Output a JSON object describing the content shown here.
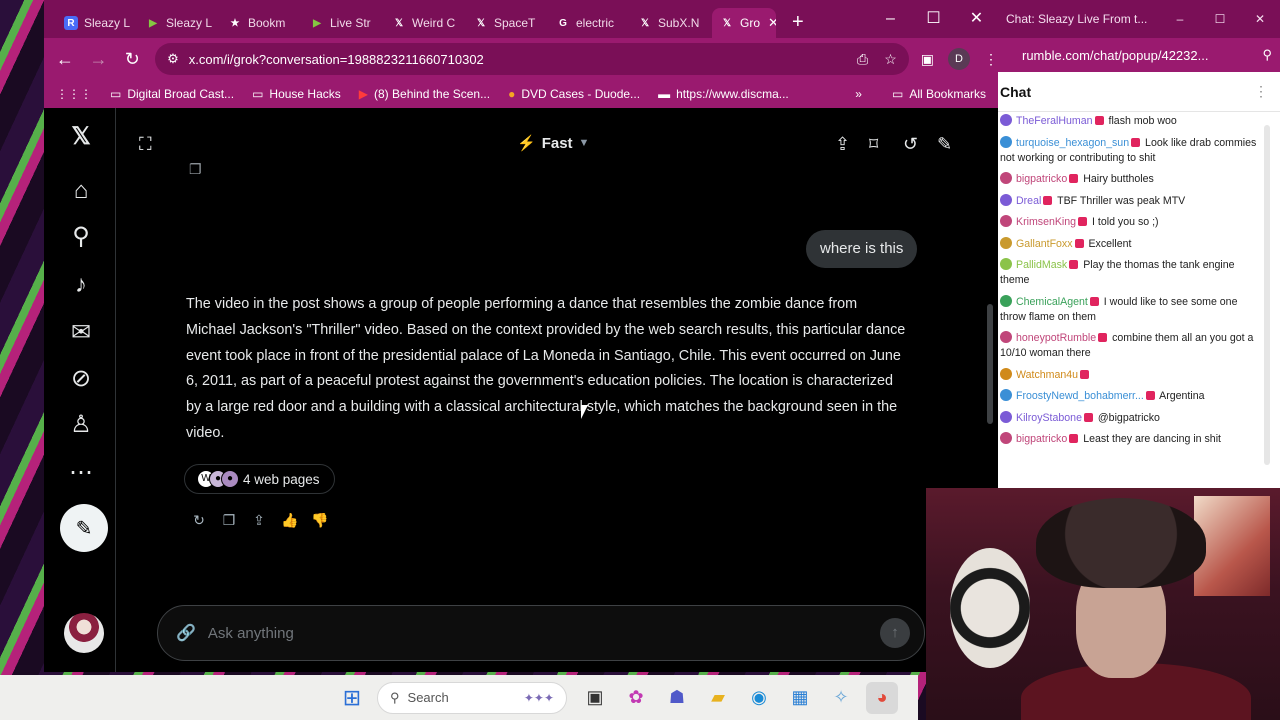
{
  "browser": {
    "tabs": [
      {
        "label": "Sleazy L",
        "icon": "rumble-R",
        "color": "#4a6cf7"
      },
      {
        "label": "Sleazy L",
        "icon": "rumble-play",
        "color": "#85c742"
      },
      {
        "label": "Bookm",
        "icon": "star-icon",
        "color": "#ffffff"
      },
      {
        "label": "Live Str",
        "icon": "rumble-play",
        "color": "#85c742"
      },
      {
        "label": "Weird C",
        "icon": "x-icon",
        "color": "#ffffff"
      },
      {
        "label": "SpaceT",
        "icon": "x-icon",
        "color": "#ffffff"
      },
      {
        "label": "electric",
        "icon": "google-icon",
        "color": "#ffffff"
      },
      {
        "label": "SubX.N",
        "icon": "x-icon",
        "color": "#ffffff"
      },
      {
        "label": "Gro",
        "icon": "x-icon",
        "color": "#ffffff",
        "active": true
      }
    ],
    "url": "x.com/i/grok?conversation=1988823211660710302",
    "profile_initial": "D",
    "bookmarks": [
      "Digital Broad Cast...",
      "House Hacks",
      "(8) Behind the Scen...",
      "DVD Cases - Duode...",
      "https://www.discma..."
    ],
    "all_bookmarks": "All Bookmarks"
  },
  "grok": {
    "model": "Fast",
    "user_message": "where is this",
    "answer": "The video in the post shows a group of people performing a dance that resembles the zombie dance from Michael Jackson's \"Thriller\" video. Based on the context provided by the web search results, this particular dance event took place in front of the presidential palace of La Moneda in Santiago, Chile. This event occurred on June 6, 2011, as part of a peaceful protest against the government's education policies. The location is characterized by a large red door and a building with a classical architectural style, which matches the background seen in the video.",
    "sources_label": "4 web pages",
    "composer_placeholder": "Ask anything"
  },
  "taskbar": {
    "search_label": "Search"
  },
  "chat": {
    "window_title": "Chat: Sleazy Live From t...",
    "url": "rumble.com/chat/popup/42232...",
    "header": "Chat",
    "messages": [
      {
        "user": "TheFeralHuman",
        "text": "flash mob woo",
        "color": "#7b5bd6"
      },
      {
        "user": "turquoise_hexagon_sun",
        "text": "Look like drab commies not working or contributing to shit",
        "color": "#3a8fd6"
      },
      {
        "user": "bigpatricko",
        "text": "Hairy buttholes",
        "color": "#c0467a"
      },
      {
        "user": "Dreal",
        "text": "TBF Thriller was peak MTV",
        "color": "#7b5bd6"
      },
      {
        "user": "KrimsenKing",
        "text": "I told you so ;)",
        "color": "#c0467a"
      },
      {
        "user": "GallantFoxx",
        "text": "Excellent",
        "color": "#c99a2e"
      },
      {
        "user": "PallidMask",
        "text": "Play the thomas the tank engine theme",
        "color": "#8bc34a"
      },
      {
        "user": "ChemicalAgent",
        "text": "I would like to see some one throw flame on them",
        "color": "#3aa15a"
      },
      {
        "user": "honeypotRumble",
        "text": "combine them all an you got a 10/10 woman there",
        "color": "#c0467a"
      },
      {
        "user": "Watchman4u",
        "text": "",
        "color": "#d08a1a"
      },
      {
        "user": "FroostyNewd_bohabmerr...",
        "text": "Argentina",
        "color": "#3a8fd6"
      },
      {
        "user": "KilroyStabone",
        "text": "@bigpatricko",
        "color": "#7b5bd6"
      },
      {
        "user": "bigpatricko",
        "text": "Least they are dancing in shit",
        "color": "#c0467a"
      }
    ]
  },
  "colors": {
    "browser_frame": "#9a1a6f",
    "tabbar": "#7a0f57",
    "x_background": "#000000",
    "text_primary": "#e7e9ea"
  }
}
